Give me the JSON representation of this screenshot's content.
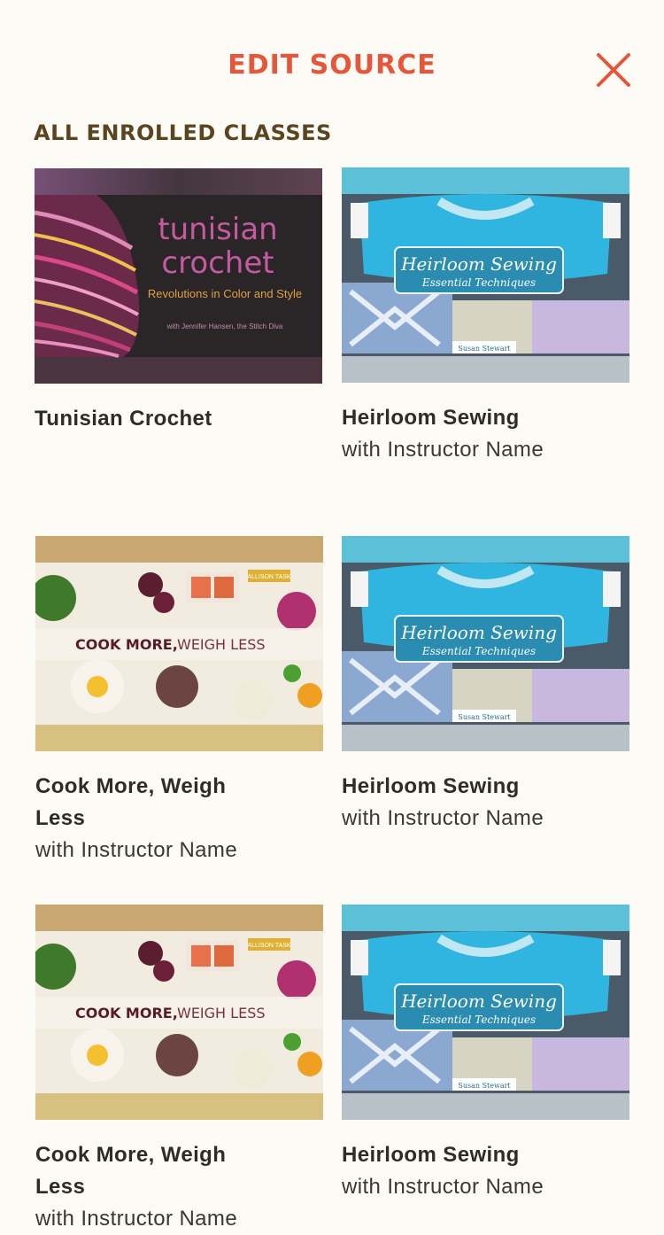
{
  "header": {
    "title": "EDIT SOURCE",
    "close_icon": "close-icon",
    "accent_color": "#e5573a"
  },
  "section": {
    "label": "ALL ENROLLED CLASSES"
  },
  "thumbnails": {
    "tunisian": {
      "line1": "tunisian",
      "line2": "crochet",
      "subtitle": "Revolutions in Color and Style",
      "credit": "with Jennifer Hansen, the Stitch Diva"
    },
    "heirloom": {
      "title": "Heirloom Sewing",
      "subtitle": "Essential Techniques",
      "author": "Susan Stewart"
    },
    "cook": {
      "author_tag": "ALLISON TASK",
      "title_bold": "COOK MORE,",
      "title_light": " WEIGH LESS"
    }
  },
  "classes": [
    {
      "title": "Tunisian Crochet",
      "instructor": ""
    },
    {
      "title": "Heirloom Sewing",
      "instructor": "with Instructor Name"
    },
    {
      "title": "Cook More, Weigh Less",
      "instructor": "with Instructor Name"
    },
    {
      "title": "Heirloom Sewing",
      "instructor": "with Instructor Name"
    },
    {
      "title": "Cook More, Weigh Less",
      "instructor": "with Instructor Name"
    },
    {
      "title": "Heirloom Sewing",
      "instructor": "with Instructor Name"
    }
  ]
}
